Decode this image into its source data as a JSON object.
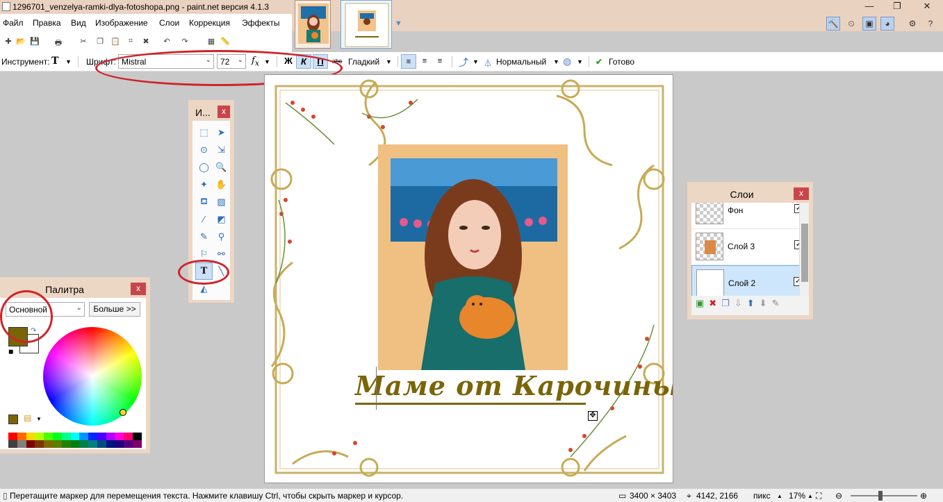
{
  "window": {
    "title": "1296701_venzelya-ramki-dlya-fotoshopa.png - paint.net версия 4.1.3",
    "controls": {
      "minimize": "—",
      "maximize": "❐",
      "close": "✕"
    }
  },
  "menu": [
    "Файл",
    "Правка",
    "Вид",
    "Изображение",
    "Слои",
    "Коррекция",
    "Эффекты"
  ],
  "toolbar": {
    "tool_label": "Инструмент:",
    "tool_glyph": "T",
    "font_label": "Шрифт:",
    "font_value": "Mistral",
    "size_value": "72",
    "bold": "Ж",
    "italic": "К",
    "underline": "П",
    "strike": "abc",
    "antialias": "Гладкий",
    "blend": "Нормальный",
    "finish": "Готово"
  },
  "tools_panel": {
    "title": "И...",
    "close": "x",
    "selected_tool_glyph": "T"
  },
  "palette_panel": {
    "title": "Палитра",
    "close": "x",
    "mode": "Основной",
    "more_button": "Больше >>",
    "primary_color": "#7a6408",
    "swatches": [
      "#ff0000",
      "#ff6a00",
      "#ffd800",
      "#b6ff00",
      "#4cff00",
      "#00ff21",
      "#00ff90",
      "#00ffff",
      "#0094ff",
      "#0026ff",
      "#4800ff",
      "#b200ff",
      "#ff00dc",
      "#ff006e",
      "#000000",
      "#404040",
      "#808080",
      "#7f0000",
      "#7f3300",
      "#7f6a00",
      "#5b7f00",
      "#267f00",
      "#007f0e",
      "#007f46",
      "#007f7f",
      "#004a7f",
      "#00137f",
      "#21007f",
      "#57007f",
      "#7f006e"
    ]
  },
  "layers_panel": {
    "title": "Слои",
    "close": "x",
    "layers": [
      {
        "name": "Фон",
        "visible": true,
        "selected": false
      },
      {
        "name": "Слой 3",
        "visible": true,
        "selected": false
      },
      {
        "name": "Слой 2",
        "visible": true,
        "selected": true
      }
    ]
  },
  "canvas": {
    "text": "Маме от Карочины"
  },
  "status": {
    "hint": "Перетащите маркер для перемещения текста. Нажмите клавишу Ctrl, чтобы скрыть маркер и курсор.",
    "image_size": "3400 × 3403",
    "cursor_pos": "4142, 2166",
    "units": "пикс",
    "zoom": "17%"
  }
}
